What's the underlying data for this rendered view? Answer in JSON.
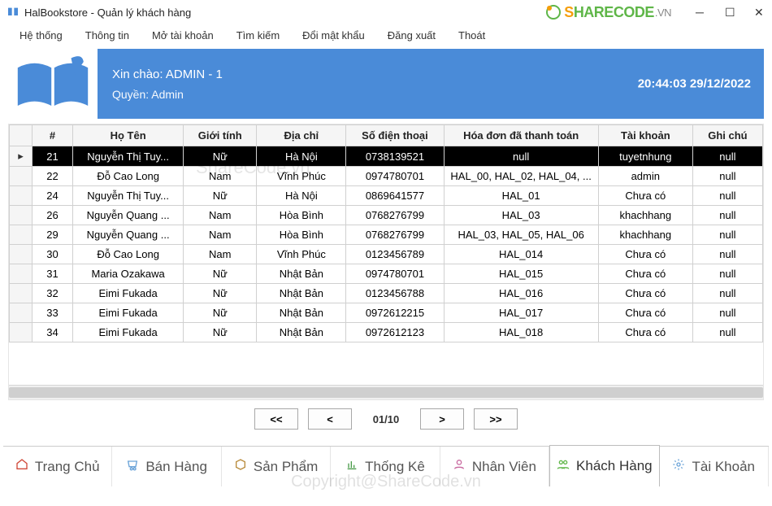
{
  "window": {
    "title": "HalBookstore - Quản lý khách hàng"
  },
  "brand": {
    "s": "S",
    "rest": "HARECODE",
    "vn": ".VN"
  },
  "menu": {
    "items": [
      "Hệ thống",
      "Thông tin",
      "Mở tài khoản",
      "Tìm kiếm",
      "Đổi mật khẩu",
      "Đăng xuất",
      "Thoát"
    ]
  },
  "banner": {
    "greeting": "Xin chào: ADMIN - 1",
    "role": "Quyền: Admin",
    "datetime": "20:44:03 29/12/2022"
  },
  "watermark": {
    "top": "ShareCode.vn",
    "bottom": "Copyright@ShareCode.vn"
  },
  "table": {
    "headers": [
      "#",
      "Họ Tên",
      "Giới tính",
      "Địa chỉ",
      "Số điện thoại",
      "Hóa đơn đã thanh toán",
      "Tài khoản",
      "Ghi chú"
    ],
    "selected_index": 0,
    "rows": [
      {
        "id": "21",
        "name": "Nguyễn Thị Tuy...",
        "sex": "Nữ",
        "addr": "Hà Nội",
        "phone": "0738139521",
        "invoices": "null",
        "account": "tuyetnhung",
        "note": "null"
      },
      {
        "id": "22",
        "name": "Đỗ Cao Long",
        "sex": "Nam",
        "addr": "Vĩnh Phúc",
        "phone": "0974780701",
        "invoices": "HAL_00, HAL_02, HAL_04, ...",
        "account": "admin",
        "note": "null"
      },
      {
        "id": "24",
        "name": "Nguyễn Thị Tuy...",
        "sex": "Nữ",
        "addr": "Hà Nội",
        "phone": "0869641577",
        "invoices": "HAL_01",
        "account": "Chưa có",
        "note": "null"
      },
      {
        "id": "26",
        "name": "Nguyễn Quang ...",
        "sex": "Nam",
        "addr": "Hòa Bình",
        "phone": "0768276799",
        "invoices": "HAL_03",
        "account": "khachhang",
        "note": "null"
      },
      {
        "id": "29",
        "name": "Nguyễn Quang ...",
        "sex": "Nam",
        "addr": "Hòa Bình",
        "phone": "0768276799",
        "invoices": "HAL_03, HAL_05, HAL_06",
        "account": "khachhang",
        "note": "null"
      },
      {
        "id": "30",
        "name": "Đỗ Cao Long",
        "sex": "Nam",
        "addr": "Vĩnh Phúc",
        "phone": "0123456789",
        "invoices": "HAL_014",
        "account": "Chưa có",
        "note": "null"
      },
      {
        "id": "31",
        "name": "Maria Ozakawa",
        "sex": "Nữ",
        "addr": "Nhật Bản",
        "phone": "0974780701",
        "invoices": "HAL_015",
        "account": "Chưa có",
        "note": "null"
      },
      {
        "id": "32",
        "name": "Eimi Fukada",
        "sex": "Nữ",
        "addr": "Nhật Bản",
        "phone": "0123456788",
        "invoices": "HAL_016",
        "account": "Chưa có",
        "note": "null"
      },
      {
        "id": "33",
        "name": "Eimi Fukada",
        "sex": "Nữ",
        "addr": "Nhật Bản",
        "phone": "0972612215",
        "invoices": "HAL_017",
        "account": "Chưa có",
        "note": "null"
      },
      {
        "id": "34",
        "name": "Eimi Fukada",
        "sex": "Nữ",
        "addr": "Nhật Bản",
        "phone": "0972612123",
        "invoices": "HAL_018",
        "account": "Chưa có",
        "note": "null"
      }
    ]
  },
  "pager": {
    "first": "<<",
    "prev": "<",
    "label": "01/10",
    "next": ">",
    "last": ">>"
  },
  "tabs": {
    "items": [
      {
        "label": "Trang Chủ",
        "icon": "home",
        "color": "#d04a3a"
      },
      {
        "label": "Bán Hàng",
        "icon": "cart",
        "color": "#6aa3d8"
      },
      {
        "label": "Sản Phẩm",
        "icon": "box",
        "color": "#b88a3a"
      },
      {
        "label": "Thống Kê",
        "icon": "chart",
        "color": "#4a9b4a"
      },
      {
        "label": "Nhân Viên",
        "icon": "user",
        "color": "#c96aa0"
      },
      {
        "label": "Khách Hàng",
        "icon": "users",
        "color": "#5fb648"
      },
      {
        "label": "Tài Khoản",
        "icon": "gear",
        "color": "#6aa3d8"
      }
    ],
    "active_index": 5
  },
  "footer_blur": " "
}
